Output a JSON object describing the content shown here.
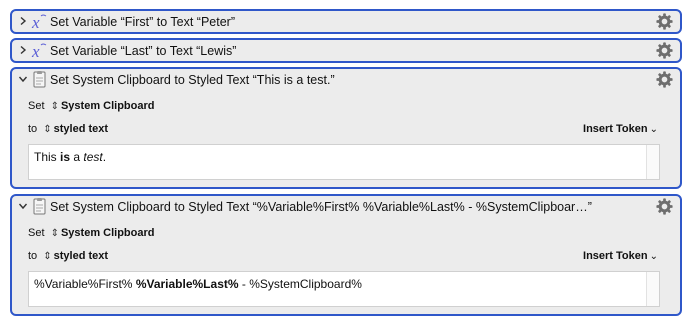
{
  "actions": [
    {
      "title": "Set Variable “First” to Text “Peter”",
      "icon": "variable-x-icon",
      "expanded": false
    },
    {
      "title": "Set Variable “Last” to Text “Lewis”",
      "icon": "variable-x-icon",
      "expanded": false
    },
    {
      "title": "Set System Clipboard to Styled Text “This is a test.”",
      "icon": "clipboard-icon",
      "expanded": true,
      "set_label": "Set",
      "set_value": "System Clipboard",
      "to_label": "to",
      "to_value": "styled text",
      "insert_token": "Insert Token",
      "text": {
        "part1": "This ",
        "part2_bold": "is",
        "part3": " a ",
        "part4_italic": "test",
        "part5": "."
      }
    },
    {
      "title": "Set System Clipboard to Styled Text “%Variable%First% %Variable%Last% - %SystemClipboar…”",
      "icon": "clipboard-icon",
      "expanded": true,
      "set_label": "Set",
      "set_value": "System Clipboard",
      "to_label": "to",
      "to_value": "styled text",
      "insert_token": "Insert Token",
      "text": {
        "part1": "%Variable%First% ",
        "part2_bold": "%Variable%Last%",
        "part3": " - %SystemClipboard%"
      }
    }
  ],
  "colors": {
    "selection_border": "#2f57c9",
    "panel_background": "#ececec",
    "variable_icon": "#5b5fd6"
  }
}
